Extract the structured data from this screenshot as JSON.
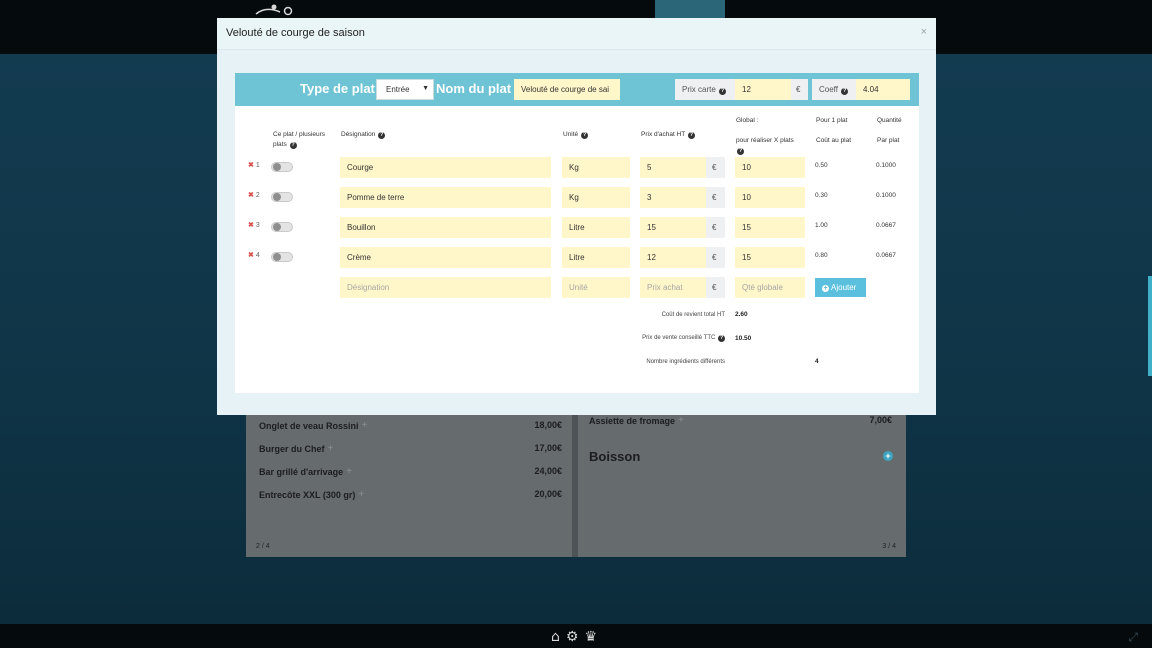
{
  "background": {
    "bottom_icons": [
      "home-icon",
      "gear-icon",
      "chef-hat-icon"
    ],
    "left_page": {
      "items": [
        {
          "name": "Onglet de veau Rossini",
          "price": "18,00€"
        },
        {
          "name": "Burger du Chef",
          "price": "17,00€"
        },
        {
          "name": "Bar grillé d'arrivage",
          "price": "24,00€"
        },
        {
          "name": "Entrecôte XXL (300 gr)",
          "price": "20,00€"
        }
      ],
      "page_number": "2 / 4"
    },
    "right_page": {
      "items": [
        {
          "name": "Assiette de fromage",
          "price": "7,00€"
        }
      ],
      "section_title": "Boisson",
      "page_number": "3 / 4"
    }
  },
  "modal": {
    "title": "Velouté de courge de saison",
    "close": "×",
    "type_label": "Type de plat :",
    "type_value": "Entrée",
    "name_label": "Nom du plat :",
    "name_value": "Velouté de courge de sai",
    "prix_carte_label": "Prix carte",
    "prix_carte_value": "12",
    "currency": "€",
    "coeff_label": "Coeff",
    "coeff_value": "4.04",
    "headers": {
      "plusieurs_1": "Ce plat / plusieurs",
      "plusieurs_2": "plats",
      "designation": "Désignation",
      "unite": "Unité",
      "prix_achat": "Prix d'achat HT",
      "global_1": "Global :",
      "global_2": "pour réaliser X plats",
      "pour1_1": "Pour 1 plat",
      "pour1_2": "Coût au plat",
      "quantite_1": "Quantité",
      "quantite_2": "Par plat"
    },
    "rows": [
      {
        "index": "1",
        "designation": "Courge",
        "unite": "Kg",
        "prix": "5",
        "qte": "10",
        "cout": "0.50",
        "par_plat": "0.1000"
      },
      {
        "index": "2",
        "designation": "Pomme de terre",
        "unite": "Kg",
        "prix": "3",
        "qte": "10",
        "cout": "0.30",
        "par_plat": "0.1000"
      },
      {
        "index": "3",
        "designation": "Bouillon",
        "unite": "Litre",
        "prix": "15",
        "qte": "15",
        "cout": "1.00",
        "par_plat": "0.0667"
      },
      {
        "index": "4",
        "designation": "Crème",
        "unite": "Litre",
        "prix": "12",
        "qte": "15",
        "cout": "0.80",
        "par_plat": "0.0667"
      }
    ],
    "new_row": {
      "designation_placeholder": "Désignation",
      "unite_placeholder": "Unité",
      "prix_placeholder": "Prix achat",
      "qte_placeholder": "Qté globale",
      "add_button": "Ajouter"
    },
    "summary": {
      "cout_label": "Coût de revient total HT",
      "cout_value": "2.60",
      "prix_vente_label": "Prix de vente conseillé TTC",
      "prix_vente_value": "10.50",
      "nb_label": "Nombre ingrédients différents",
      "nb_value": "4"
    }
  }
}
